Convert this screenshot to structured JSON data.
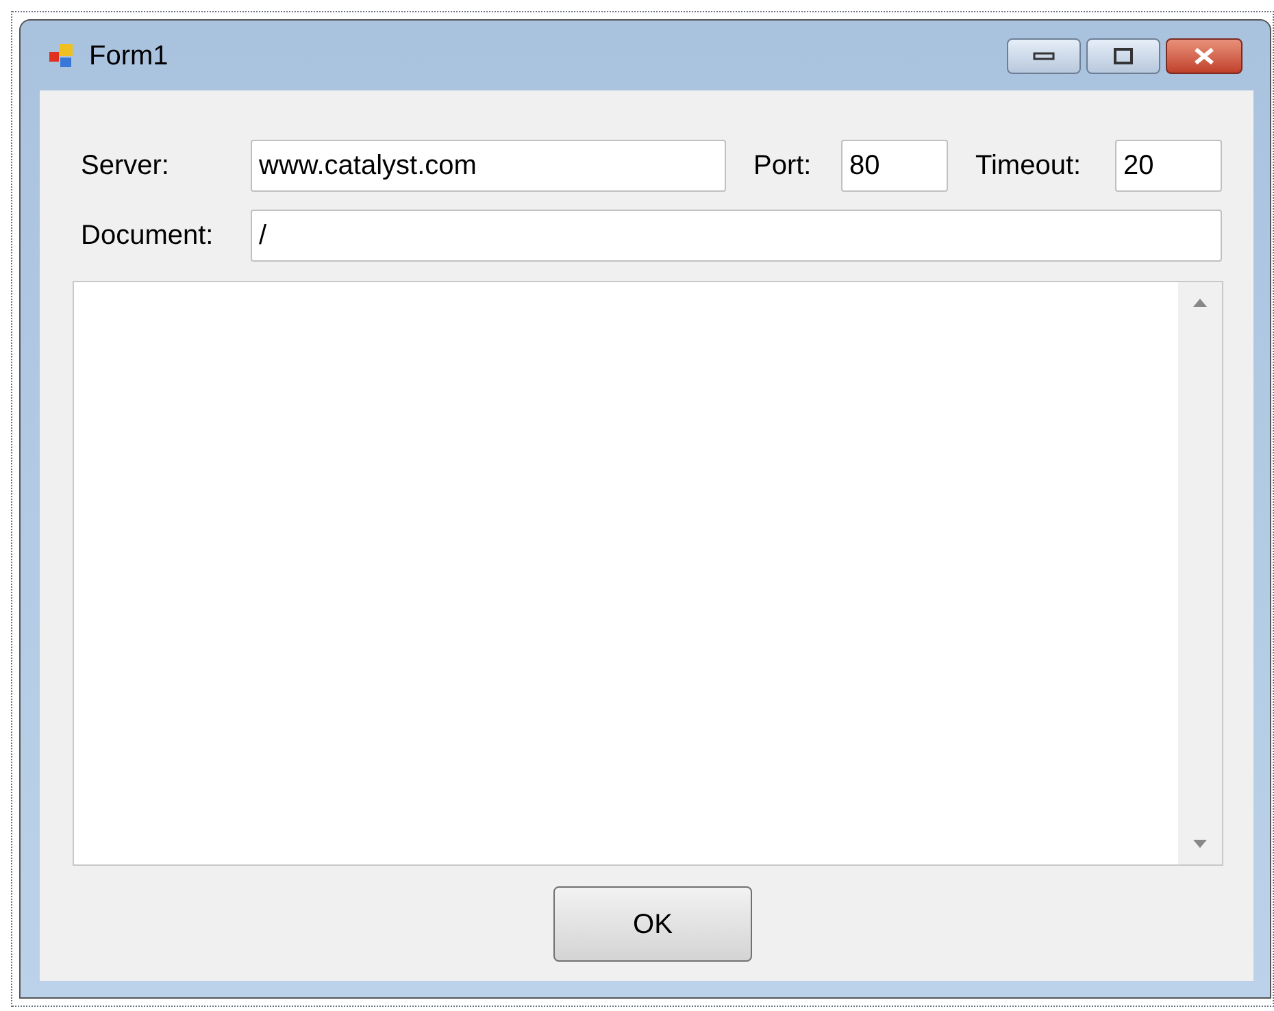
{
  "window": {
    "title": "Form1"
  },
  "row_1": [
    {
      "label": "Server:",
      "value": "www.catalyst.com"
    },
    {
      "label": "Port:",
      "value": "80"
    },
    {
      "label": "Timeout:",
      "value": "20"
    }
  ],
  "document": {
    "label": "Document:",
    "value": "/"
  },
  "buttons": [
    "OK"
  ]
}
